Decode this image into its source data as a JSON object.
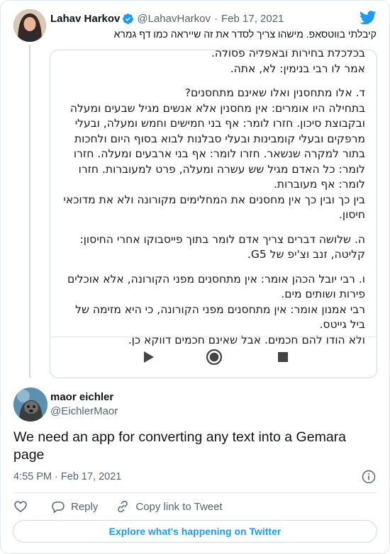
{
  "quoted_tweet": {
    "author_name": "Lahav Harkov",
    "handle": "@LahavHarkov",
    "separator": "·",
    "date": "Feb 17, 2021",
    "text": "קיבלתי בווטסאפ. מישהו צריך לסדר את זה שייראה כמו דף גמרא",
    "media_document_lines": [
      "בכלכלת בחירות ובאפליה פסולה.",
      "אמר לו רבי בנימין: לא, אתה.",
      "",
      "ד. אלו מתחסנין ואלו שאינם מתחסנים?",
      "בתחילה היו אומרים: אין מחסנין אלא אנשים מגיל שבעים ומעלה",
      "ובקבוצת סיכון. חזרו לומר: אף בני חמישים וחמש ומעלה, ובעלי",
      "מרפקים ובעלי קומבינות ובעלי סבלנות לבוא בסוף היום ולחכות",
      "בתור למקרה שנשאר. חזרו לומר: אף בני ארבעים ומעלה. חזרו",
      "לומר: כל האדם מגיל שש עשרה ומעלה, פרט למעוברות. חזרו",
      "לומר: אף מעוברות.",
      "בין כך ובין כך אין מחסנים את המחלימים מקורונה ולא את מדוכאי",
      "חיסון.",
      "",
      "ה. שלושה דברים צריך אדם לומר בתוך פייסבוקו אחרי החיסון:",
      "קליטה, זנב וצ'יפ של G5.",
      "",
      "ו. רבי יובל הכהן אומר: אין מתחסנים מפני הקורונה, אלא אוכלים",
      "פירות ושותים מים.",
      "רבי אמנון אומר: אין מתחסנים מפני הקורונה, כי היא מזימה של",
      "ביל גייטס.",
      "ולא הודו להם חכמים. אבל שאינם חכמים דווקא כן."
    ]
  },
  "main_tweet": {
    "author_name": "maor eichler",
    "handle": "@EichlerMaor",
    "text": "We need an app for converting any text into a Gemara page",
    "time": "4:55 PM",
    "separator": "·",
    "date": "Feb 17, 2021"
  },
  "actions": {
    "reply_label": "Reply",
    "copy_link_label": "Copy link to Tweet"
  },
  "explore_label": "Explore what's happening on Twitter",
  "colors": {
    "twitter_blue": "#1d9bf0",
    "text_primary": "#0f1419",
    "text_secondary": "#536471",
    "border": "#cfd9de"
  }
}
